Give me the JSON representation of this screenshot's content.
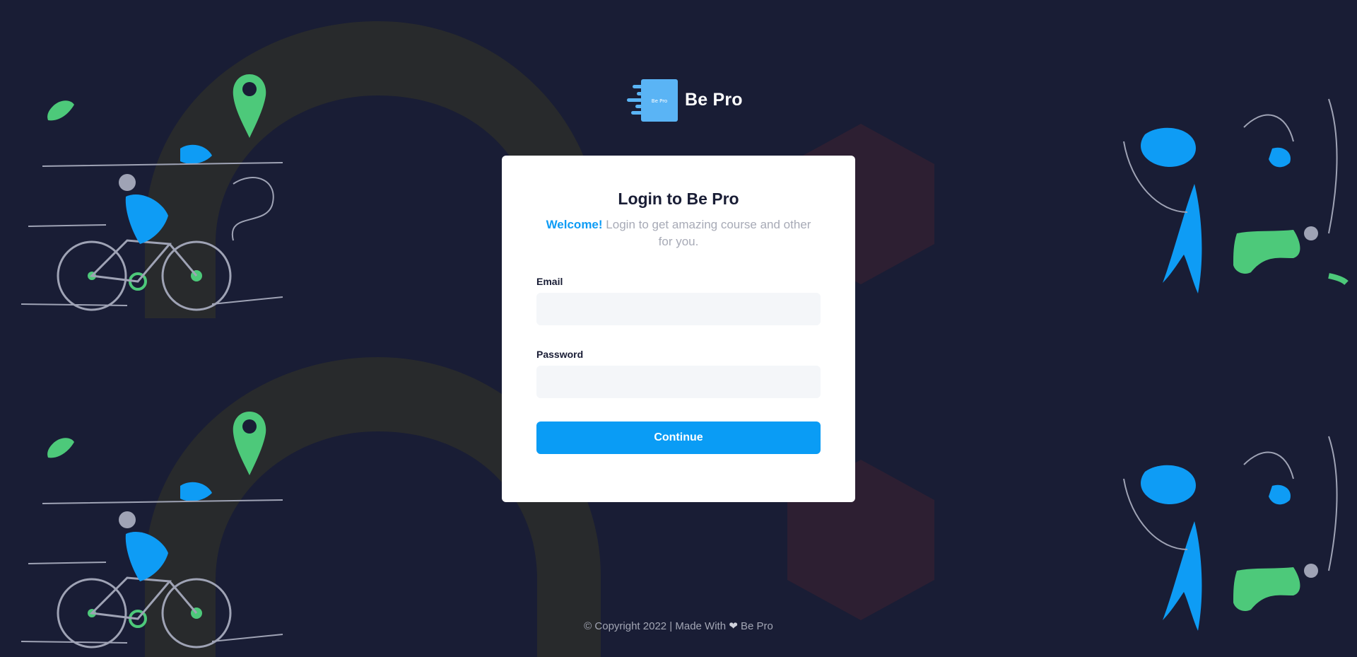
{
  "brand": {
    "name": "Be Pro",
    "logo_text": "Be Pro",
    "logo_color": "#5ab4f5"
  },
  "login": {
    "title": "Login to Be Pro",
    "welcome": "Welcome!",
    "subtitle": "Login to get amazing course and other for you.",
    "email_label": "Email",
    "email_value": "",
    "email_placeholder": "",
    "password_label": "Password",
    "password_value": "",
    "password_placeholder": "",
    "continue_label": "Continue"
  },
  "footer": {
    "prefix": "© Copyright 2022 | Made With",
    "heart_icon": "heart-icon",
    "suffix": "Be Pro"
  },
  "colors": {
    "background": "#191d35",
    "accent": "#0a9cf5",
    "card": "#ffffff",
    "input_bg": "#f4f6f9",
    "green": "#4dc97a"
  }
}
